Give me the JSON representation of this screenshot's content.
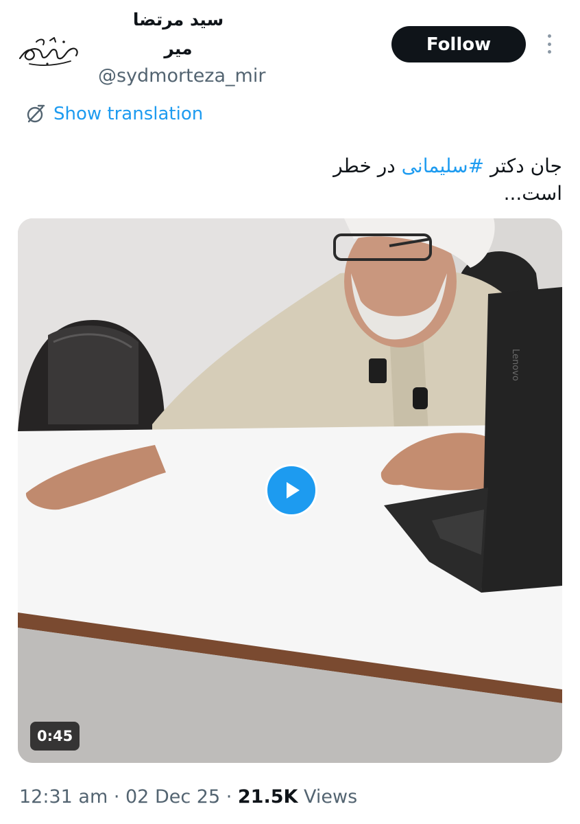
{
  "author": {
    "display_name_line1": "سید مرتضا",
    "display_name_line2": "میر",
    "handle": "@sydmorteza_mir",
    "avatar_icon": "signature-avatar-icon"
  },
  "actions": {
    "follow_label": "Follow",
    "more_icon": "more-vertical-icon"
  },
  "translation": {
    "label": "Show translation",
    "icon": "translate-globe-icon"
  },
  "tweet": {
    "text_before_line1": "جان دکتر ",
    "hashtag": "#سلیمانی",
    "text_after_line1": " در خطر",
    "text_line2": "است..."
  },
  "media": {
    "type": "video",
    "duration": "0:45",
    "play_icon": "play-icon",
    "laptop_brand": "Lenovo"
  },
  "meta": {
    "time": "12:31 am",
    "separator": " · ",
    "date": "02 Dec 25",
    "views_count": "21.5K",
    "views_label": " Views"
  },
  "colors": {
    "accent": "#1d9bf0",
    "text_primary": "#0f1419",
    "text_secondary": "#536471",
    "follow_bg": "#0f1419"
  }
}
